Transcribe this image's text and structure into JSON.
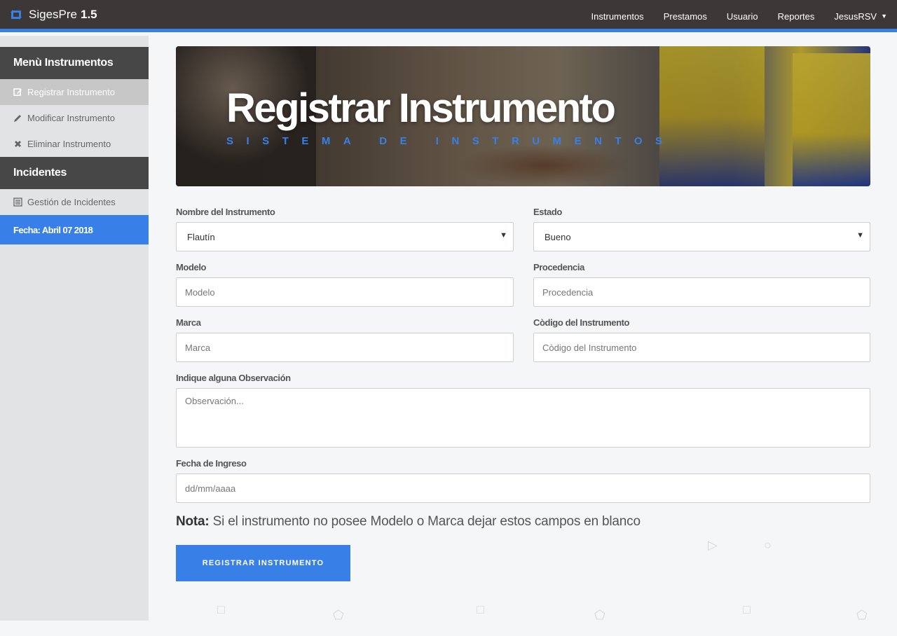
{
  "navbar": {
    "brand_name": "SigesPre",
    "brand_version": "1.5",
    "links": [
      "Instrumentos",
      "Prestamos",
      "Usuario",
      "Reportes"
    ],
    "user_menu": "JesusRSV",
    "accent_color": "#3880e8"
  },
  "sidebar": {
    "section1_title": "Menù Instrumentos",
    "items": [
      {
        "label": "Registrar Instrumento",
        "icon": "edit-icon",
        "active": true
      },
      {
        "label": "Modificar Instrumento",
        "icon": "pencil-icon"
      },
      {
        "label": "Eliminar Instrumento",
        "icon": "x-icon"
      }
    ],
    "section2_title": "Incidentes",
    "items2": [
      {
        "label": "Gestión de Incidentes",
        "icon": "list-icon"
      }
    ],
    "date_label": "Fecha: Abril 07 2018"
  },
  "banner": {
    "title": "Registrar Instrumento",
    "subtitle": "SISTEMA DE INSTRUMENTOS"
  },
  "form": {
    "nombre_label": "Nombre del Instrumento",
    "nombre_value": "Flautín",
    "estado_label": "Estado",
    "estado_value": "Bueno",
    "modelo_label": "Modelo",
    "modelo_placeholder": "Modelo",
    "procedencia_label": "Procedencia",
    "procedencia_placeholder": "Procedencia",
    "marca_label": "Marca",
    "marca_placeholder": "Marca",
    "codigo_label": "Còdigo del Instrumento",
    "codigo_placeholder": "Còdigo del Instrumento",
    "observacion_label": "Indique alguna Observación",
    "observacion_placeholder": "Observación...",
    "fecha_label": "Fecha de Ingreso",
    "fecha_placeholder": "dd/mm/aaaa",
    "nota_bold": "Nota:",
    "nota_text": "Si el instrumento no posee Modelo o Marca dejar estos campos en blanco",
    "submit_label": "REGISTRAR INSTRUMENTO"
  }
}
